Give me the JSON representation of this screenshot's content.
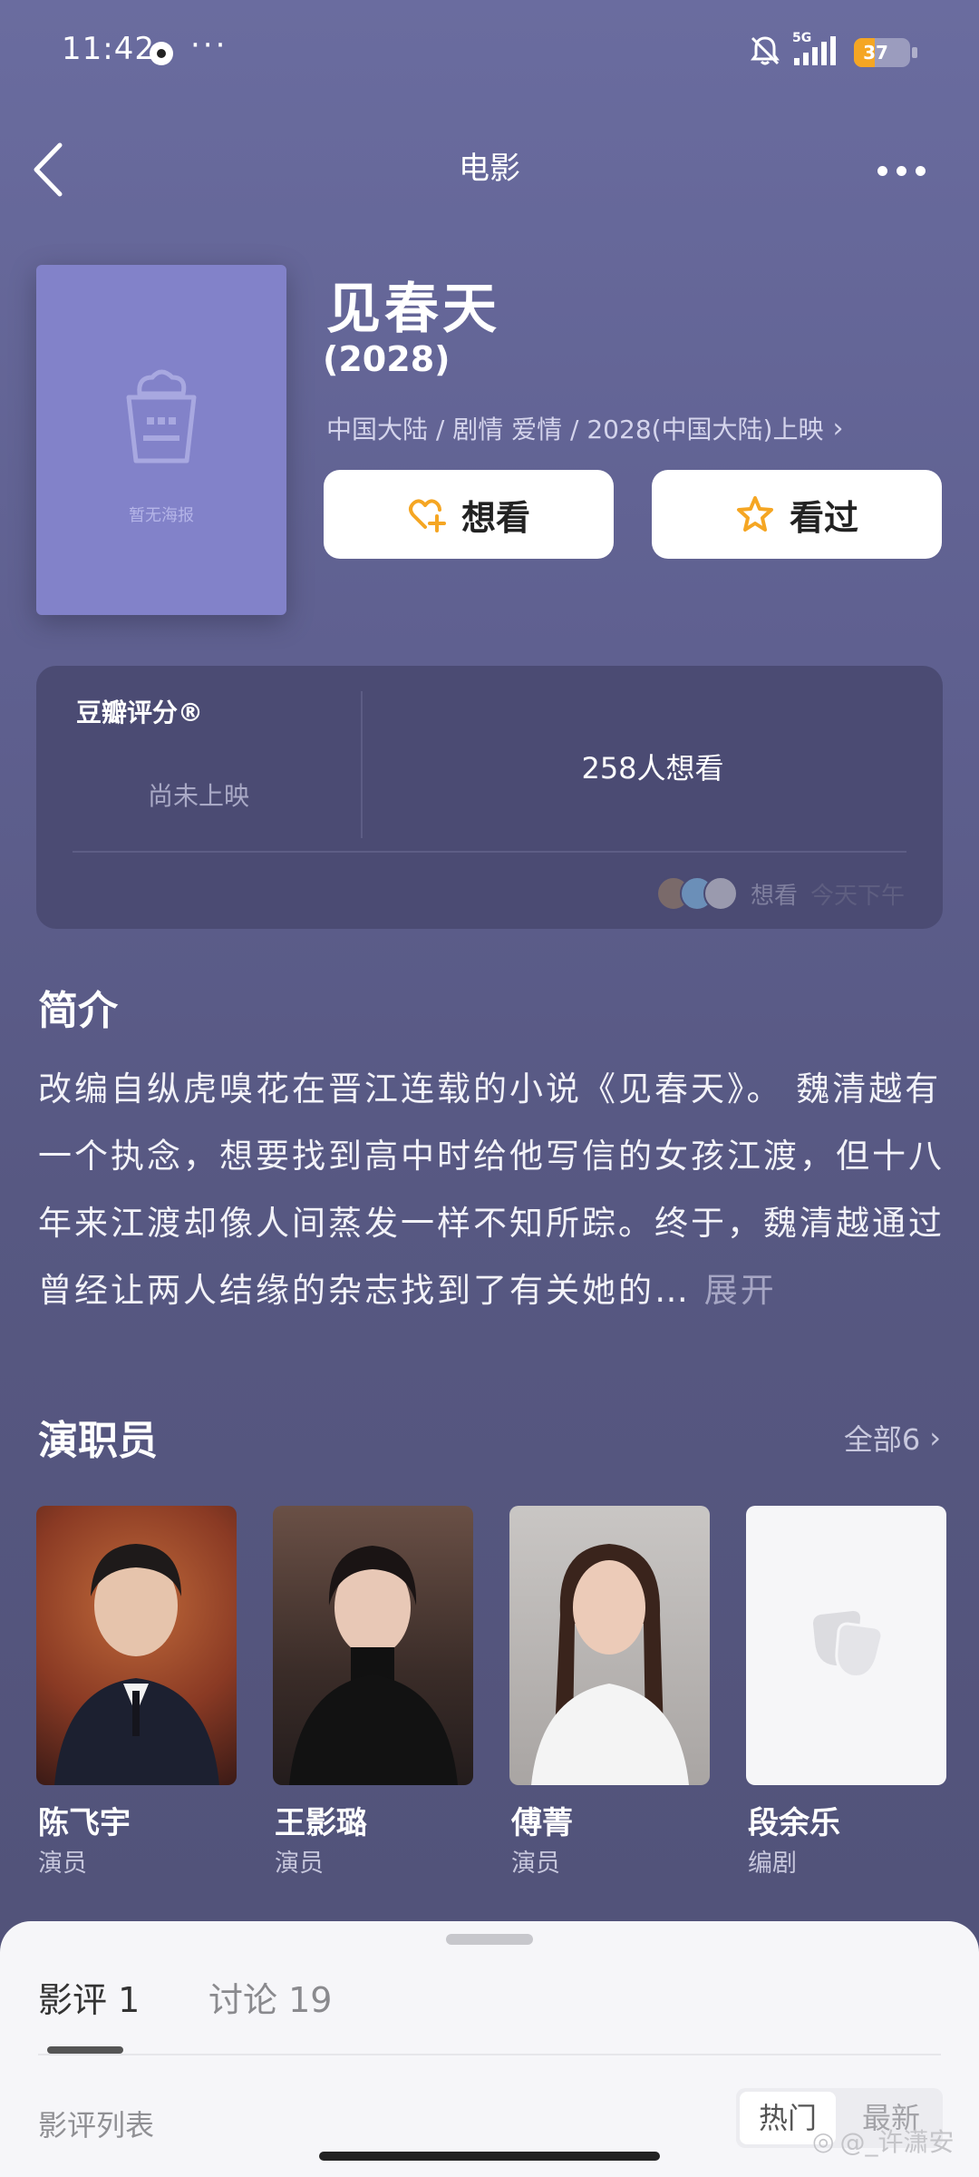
{
  "status_bar": {
    "time": "11:42",
    "dots": "···",
    "network": "5G",
    "battery": 37
  },
  "nav": {
    "title": "电影"
  },
  "movie": {
    "poster_placeholder": "暂无海报",
    "title": "见春天",
    "year": "(2028)",
    "meta": "中国大陆 / 剧情 爱情 / 2028(中国大陆)上映",
    "want_label": "想看",
    "seen_label": "看过"
  },
  "rating": {
    "label": "豆瓣评分®",
    "status": "尚未上映",
    "wants": "258人想看",
    "activity": "想看",
    "activity_time": "今天下午"
  },
  "intro": {
    "title": "简介",
    "text": "改编自纵虎嗅花在晋江连载的小说《见春天》。 魏清越有一个执念，想要找到高中时给他写信的女孩江渡，但十八年来江渡却像人间蒸发一样不知所踪。终于，魏清越通过曾经让两人结缘的杂志找到了有关她的…",
    "more": "展开"
  },
  "cast": {
    "title": "演职员",
    "all_label": "全部6",
    "items": [
      {
        "name": "陈飞宇",
        "role": "演员"
      },
      {
        "name": "王影璐",
        "role": "演员"
      },
      {
        "name": "傅菁",
        "role": "演员"
      },
      {
        "name": "段余乐",
        "role": "编剧"
      }
    ]
  },
  "sheet": {
    "tabs": [
      {
        "label": "影评 1"
      },
      {
        "label": "讨论 19"
      }
    ],
    "list_label": "影评列表",
    "sort": {
      "hot": "热门",
      "new": "最新"
    }
  },
  "watermark": "@_许潇安",
  "colors": {
    "background": "#5f6090",
    "poster": "#8282c9",
    "card": "#4b4b73",
    "accent_orange": "#f5a623"
  }
}
